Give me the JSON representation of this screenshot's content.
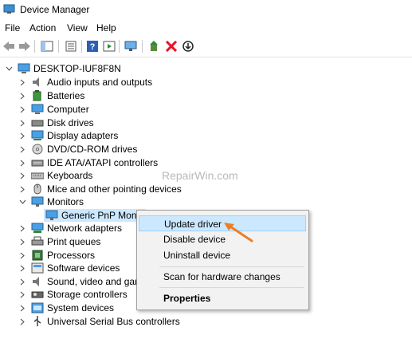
{
  "window": {
    "title": "Device Manager"
  },
  "menubar": {
    "items": [
      "File",
      "Action",
      "View",
      "Help"
    ]
  },
  "tree": {
    "root": "DESKTOP-IUF8F8N",
    "categories": [
      "Audio inputs and outputs",
      "Batteries",
      "Computer",
      "Disk drives",
      "Display adapters",
      "DVD/CD-ROM drives",
      "IDE ATA/ATAPI controllers",
      "Keyboards",
      "Mice and other pointing devices",
      "Monitors",
      "Network adapters",
      "Print queues",
      "Processors",
      "Software devices",
      "Sound, video and gam",
      "Storage controllers",
      "System devices",
      "Universal Serial Bus controllers"
    ],
    "monitor_child": "Generic PnP Monito"
  },
  "context_menu": {
    "update": "Update driver",
    "disable": "Disable device",
    "uninstall": "Uninstall device",
    "scan": "Scan for hardware changes",
    "properties": "Properties"
  },
  "watermark": "RepairWin.com",
  "colors": {
    "selection": "#cce8ff",
    "arrow": "#f07d22",
    "uninstall_x": "#e81123"
  }
}
